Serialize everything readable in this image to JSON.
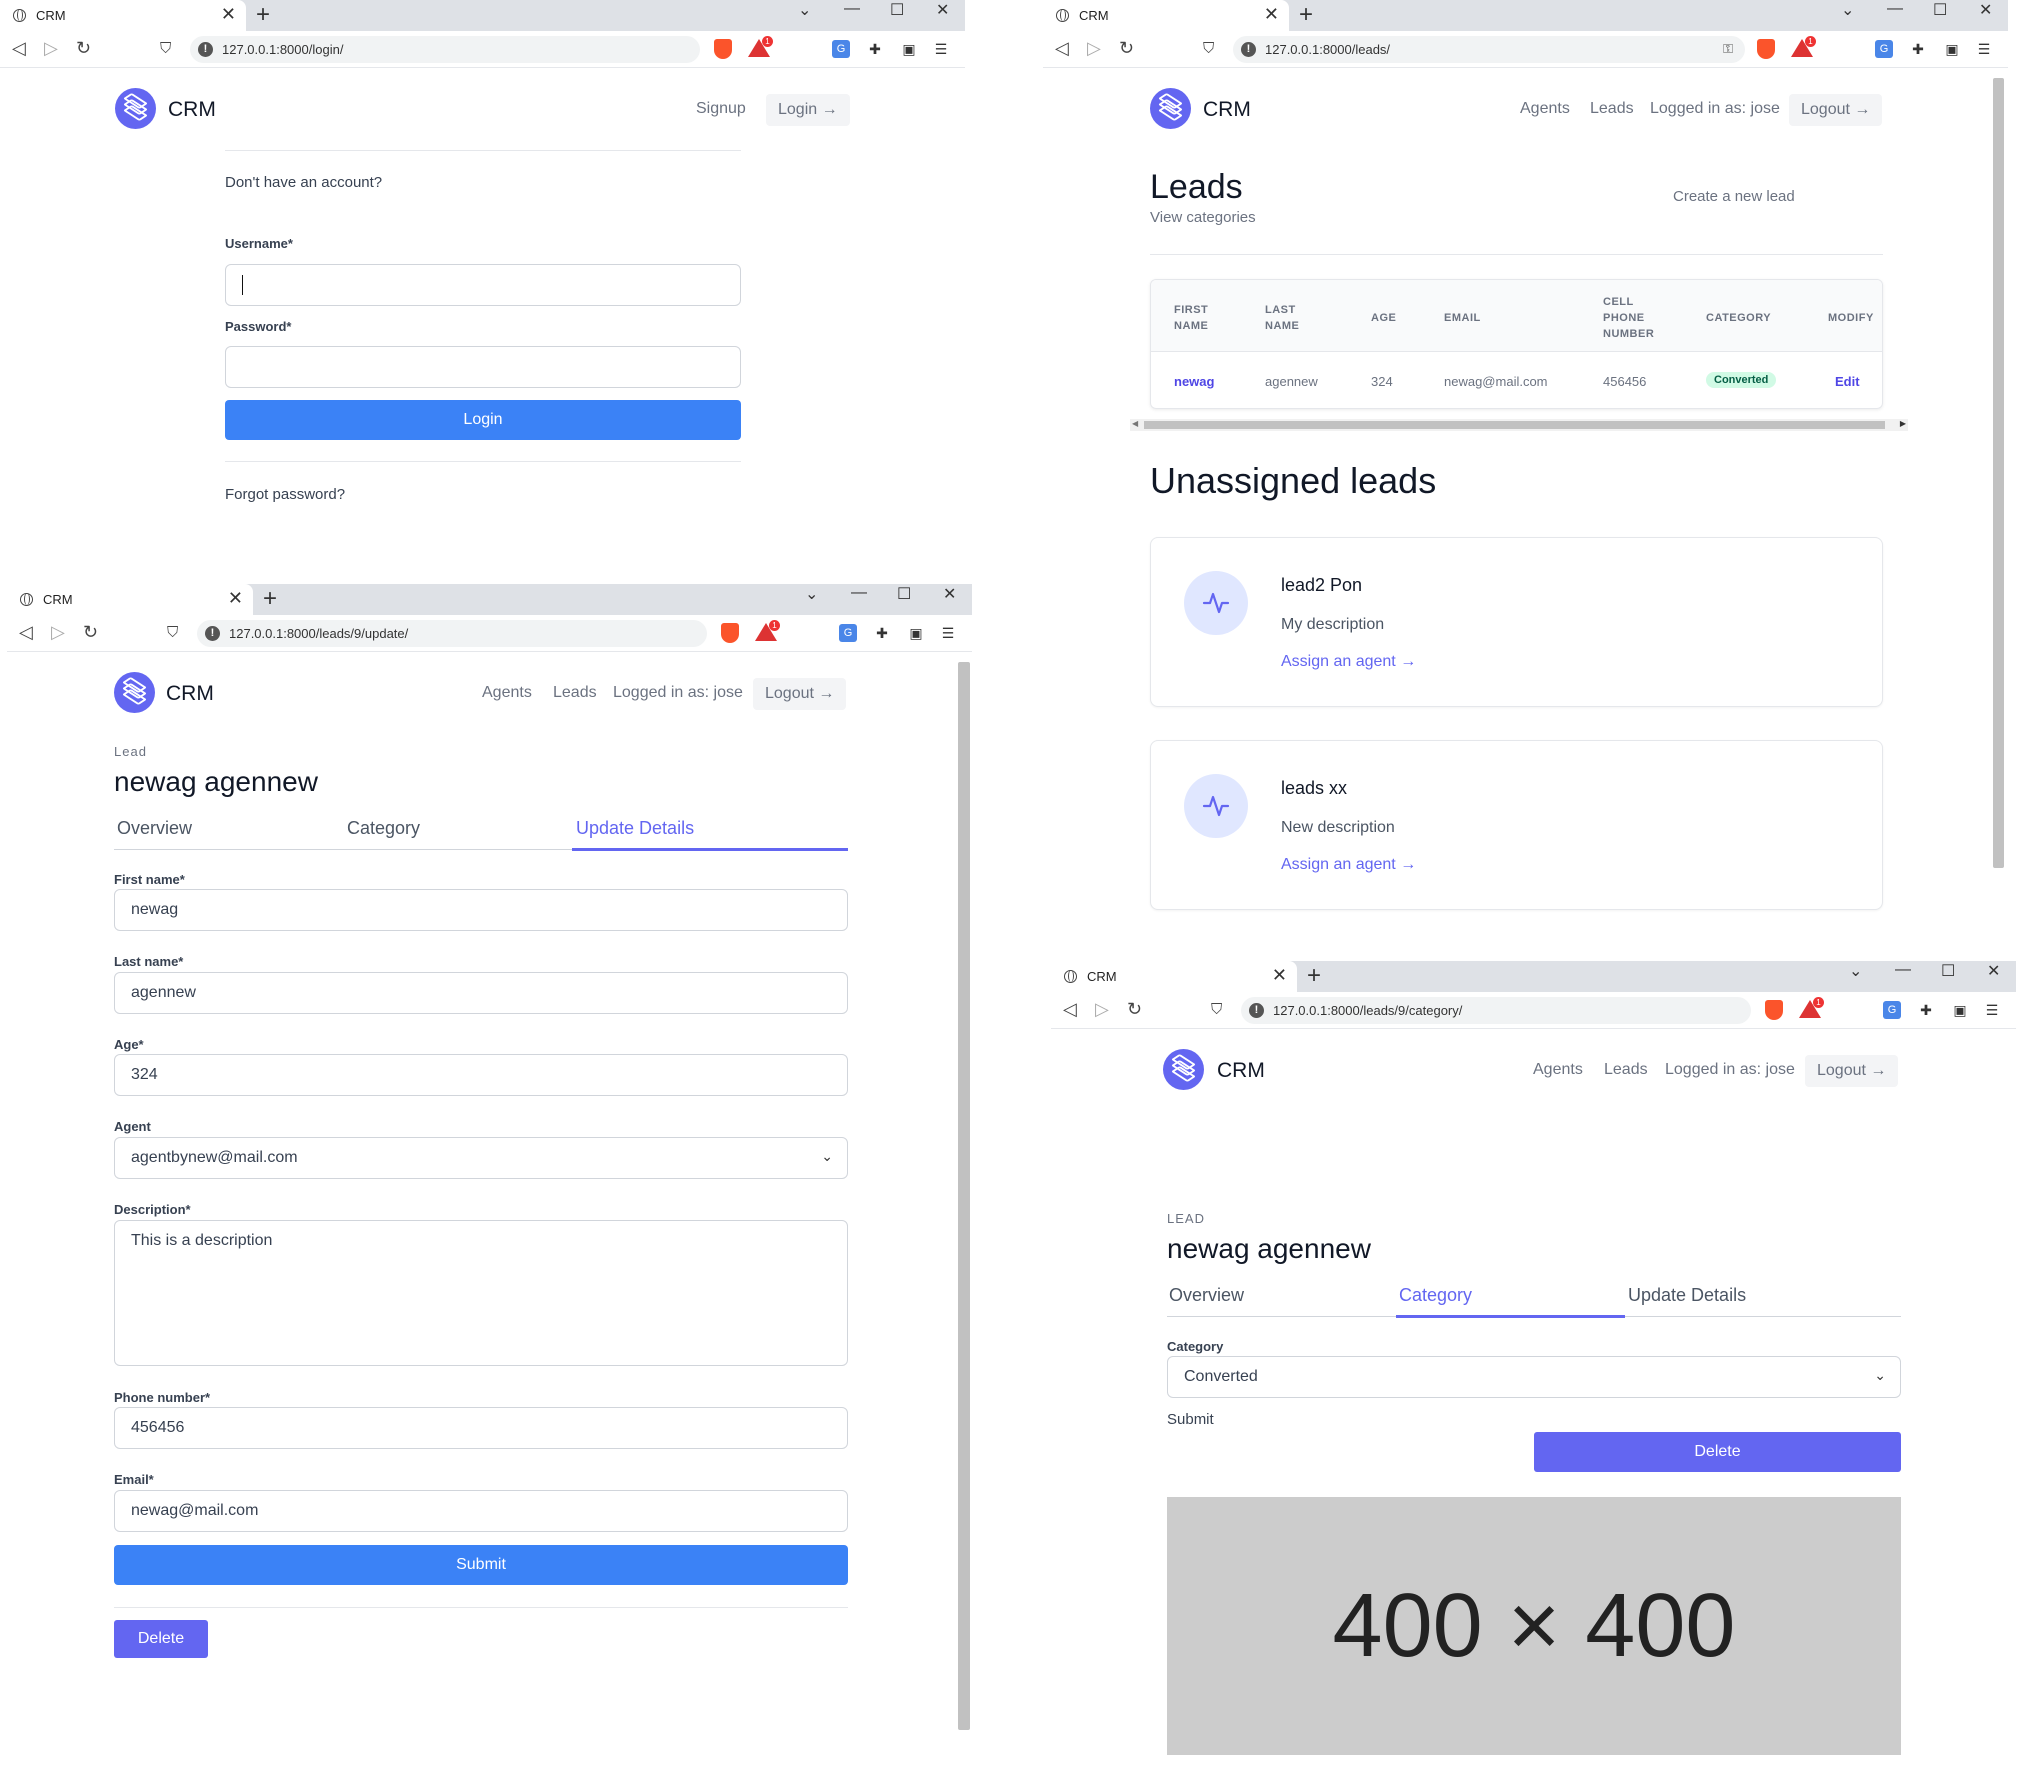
{
  "browser": {
    "tab_title": "CRM",
    "tab_close": "✕",
    "new_tab": "+",
    "controls": {
      "dropdown": "⌄",
      "minimize": "—",
      "maximize": "☐",
      "close": "✕"
    },
    "nav": {
      "back": "◁",
      "forward": "▷",
      "reload": "↻",
      "bookmark": "⛉"
    }
  },
  "brand": {
    "name": "CRM",
    "accent": "#6366f1",
    "primary_button": "#3b82f6"
  },
  "login_window": {
    "url": "127.0.0.1:8000/login/",
    "nav": {
      "signup": "Signup",
      "login": "Login →"
    },
    "prompt": "Don't have an account?",
    "username_label": "Username*",
    "password_label": "Password*",
    "login_button": "Login",
    "forgot": "Forgot password?"
  },
  "leads_window": {
    "url": "127.0.0.1:8000/leads/",
    "nav": {
      "agents": "Agents",
      "leads": "Leads",
      "logged_in": "Logged in as: jose",
      "logout": "Logout →"
    },
    "title": "Leads",
    "view_categories": "View categories",
    "create_lead": "Create a new lead",
    "table": {
      "headers": [
        "FIRST NAME",
        "LAST NAME",
        "AGE",
        "EMAIL",
        "CELL PHONE NUMBER",
        "CATEGORY",
        "MODIFY"
      ],
      "row": {
        "first": "newag",
        "last": "agennew",
        "age": "324",
        "email": "newag@mail.com",
        "phone": "456456",
        "category": "Converted",
        "modify": "Edit"
      }
    },
    "unassigned_title": "Unassigned leads",
    "unassigned": [
      {
        "name": "lead2 Pon",
        "description": "My description",
        "assign": "Assign an agent →"
      },
      {
        "name": "leads xx",
        "description": "New description",
        "assign": "Assign an agent →"
      }
    ]
  },
  "update_window": {
    "url": "127.0.0.1:8000/leads/9/update/",
    "nav": {
      "agents": "Agents",
      "leads": "Leads",
      "logged_in": "Logged in as: jose",
      "logout": "Logout →"
    },
    "eyebrow": "Lead",
    "title": "newag agennew",
    "tabs": [
      "Overview",
      "Category",
      "Update Details"
    ],
    "active_tab": "Update Details",
    "fields": {
      "first_name_label": "First name*",
      "first_name": "newag",
      "last_name_label": "Last name*",
      "last_name": "agennew",
      "age_label": "Age*",
      "age": "324",
      "agent_label": "Agent",
      "agent": "agentbynew@mail.com",
      "description_label": "Description*",
      "description": "This is a description",
      "phone_label": "Phone number*",
      "phone": "456456",
      "email_label": "Email*",
      "email": "newag@mail.com"
    },
    "submit": "Submit",
    "delete": "Delete"
  },
  "category_window": {
    "url": "127.0.0.1:8000/leads/9/category/",
    "nav": {
      "agents": "Agents",
      "leads": "Leads",
      "logged_in": "Logged in as: jose",
      "logout": "Logout →"
    },
    "eyebrow": "LEAD",
    "title": "newag agennew",
    "tabs": [
      "Overview",
      "Category",
      "Update Details"
    ],
    "active_tab": "Category",
    "category_label": "Category",
    "category_value": "Converted",
    "submit": "Submit",
    "delete": "Delete",
    "placeholder_image": "400 × 400"
  }
}
